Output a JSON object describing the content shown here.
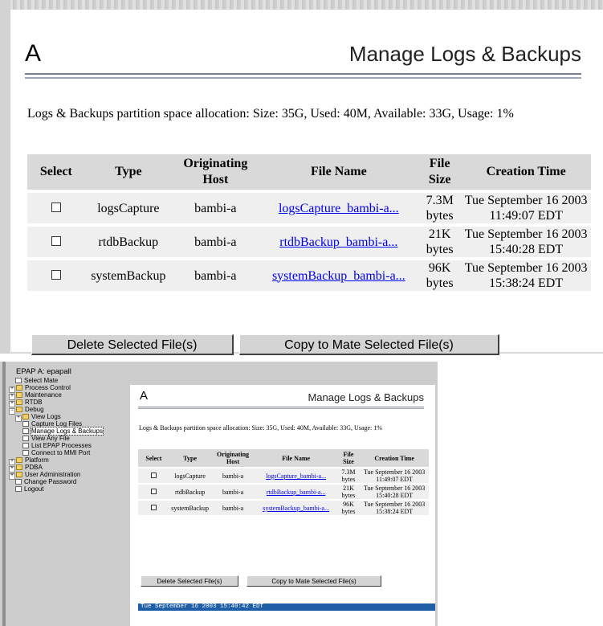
{
  "page": {
    "letter": "A",
    "title": "Manage Logs & Backups",
    "partition_info": "Logs & Backups partition space allocation: Size: 35G, Used: 40M, Available: 33G, Usage: 1%"
  },
  "table": {
    "headers": [
      "Select",
      "Type",
      "Originating Host",
      "File Name",
      "File Size",
      "Creation Time"
    ],
    "rows": [
      {
        "type": "logsCapture",
        "host": "bambi-a",
        "file": "logsCapture_bambi-a...",
        "size": "7.3M bytes",
        "time": "Tue September 16 2003 11:49:07 EDT"
      },
      {
        "type": "rtdbBackup",
        "host": "bambi-a",
        "file": "rtdbBackup_bambi-a...",
        "size": "21K bytes",
        "time": "Tue September 16 2003 15:40:28 EDT"
      },
      {
        "type": "systemBackup",
        "host": "bambi-a",
        "file": "systemBackup_bambi-a...",
        "size": "96K bytes",
        "time": "Tue September 16 2003 15:38:24 EDT"
      }
    ]
  },
  "buttons": {
    "delete": "Delete Selected File(s)",
    "copy": "Copy to Mate Selected File(s)"
  },
  "nav": {
    "header": "EPAP A: epapall",
    "items": [
      {
        "label": "Select Mate",
        "icon": "page-icon"
      },
      {
        "label": "Process Control",
        "icon": "folder-icon"
      },
      {
        "label": "Maintenance",
        "icon": "folder-icon"
      },
      {
        "label": "RTDB",
        "icon": "folder-icon"
      },
      {
        "label": "Debug",
        "icon": "folder-open-icon"
      },
      {
        "label": "View Logs",
        "icon": "folder-icon"
      },
      {
        "label": "Capture Log Files",
        "icon": "page-icon"
      },
      {
        "label": "Manage Logs & Backups",
        "icon": "page-icon"
      },
      {
        "label": "View Any File",
        "icon": "page-icon"
      },
      {
        "label": "List EPAP Processes",
        "icon": "page-icon"
      },
      {
        "label": "Connect to MMI Port",
        "icon": "page-icon"
      },
      {
        "label": "Platform",
        "icon": "folder-icon"
      },
      {
        "label": "PDBA",
        "icon": "folder-icon"
      },
      {
        "label": "User Administration",
        "icon": "folder-icon"
      },
      {
        "label": "Change Password",
        "icon": "page-icon"
      },
      {
        "label": "Logout",
        "icon": "page-icon"
      }
    ]
  },
  "status_bar": "Tue September 16 2003 15:40:42 EDT",
  "colors": {
    "link": "#0000ee",
    "status_bar": "#1f5fa8",
    "header_bg": "#d9d9d9",
    "row_bg": "#efefef"
  }
}
